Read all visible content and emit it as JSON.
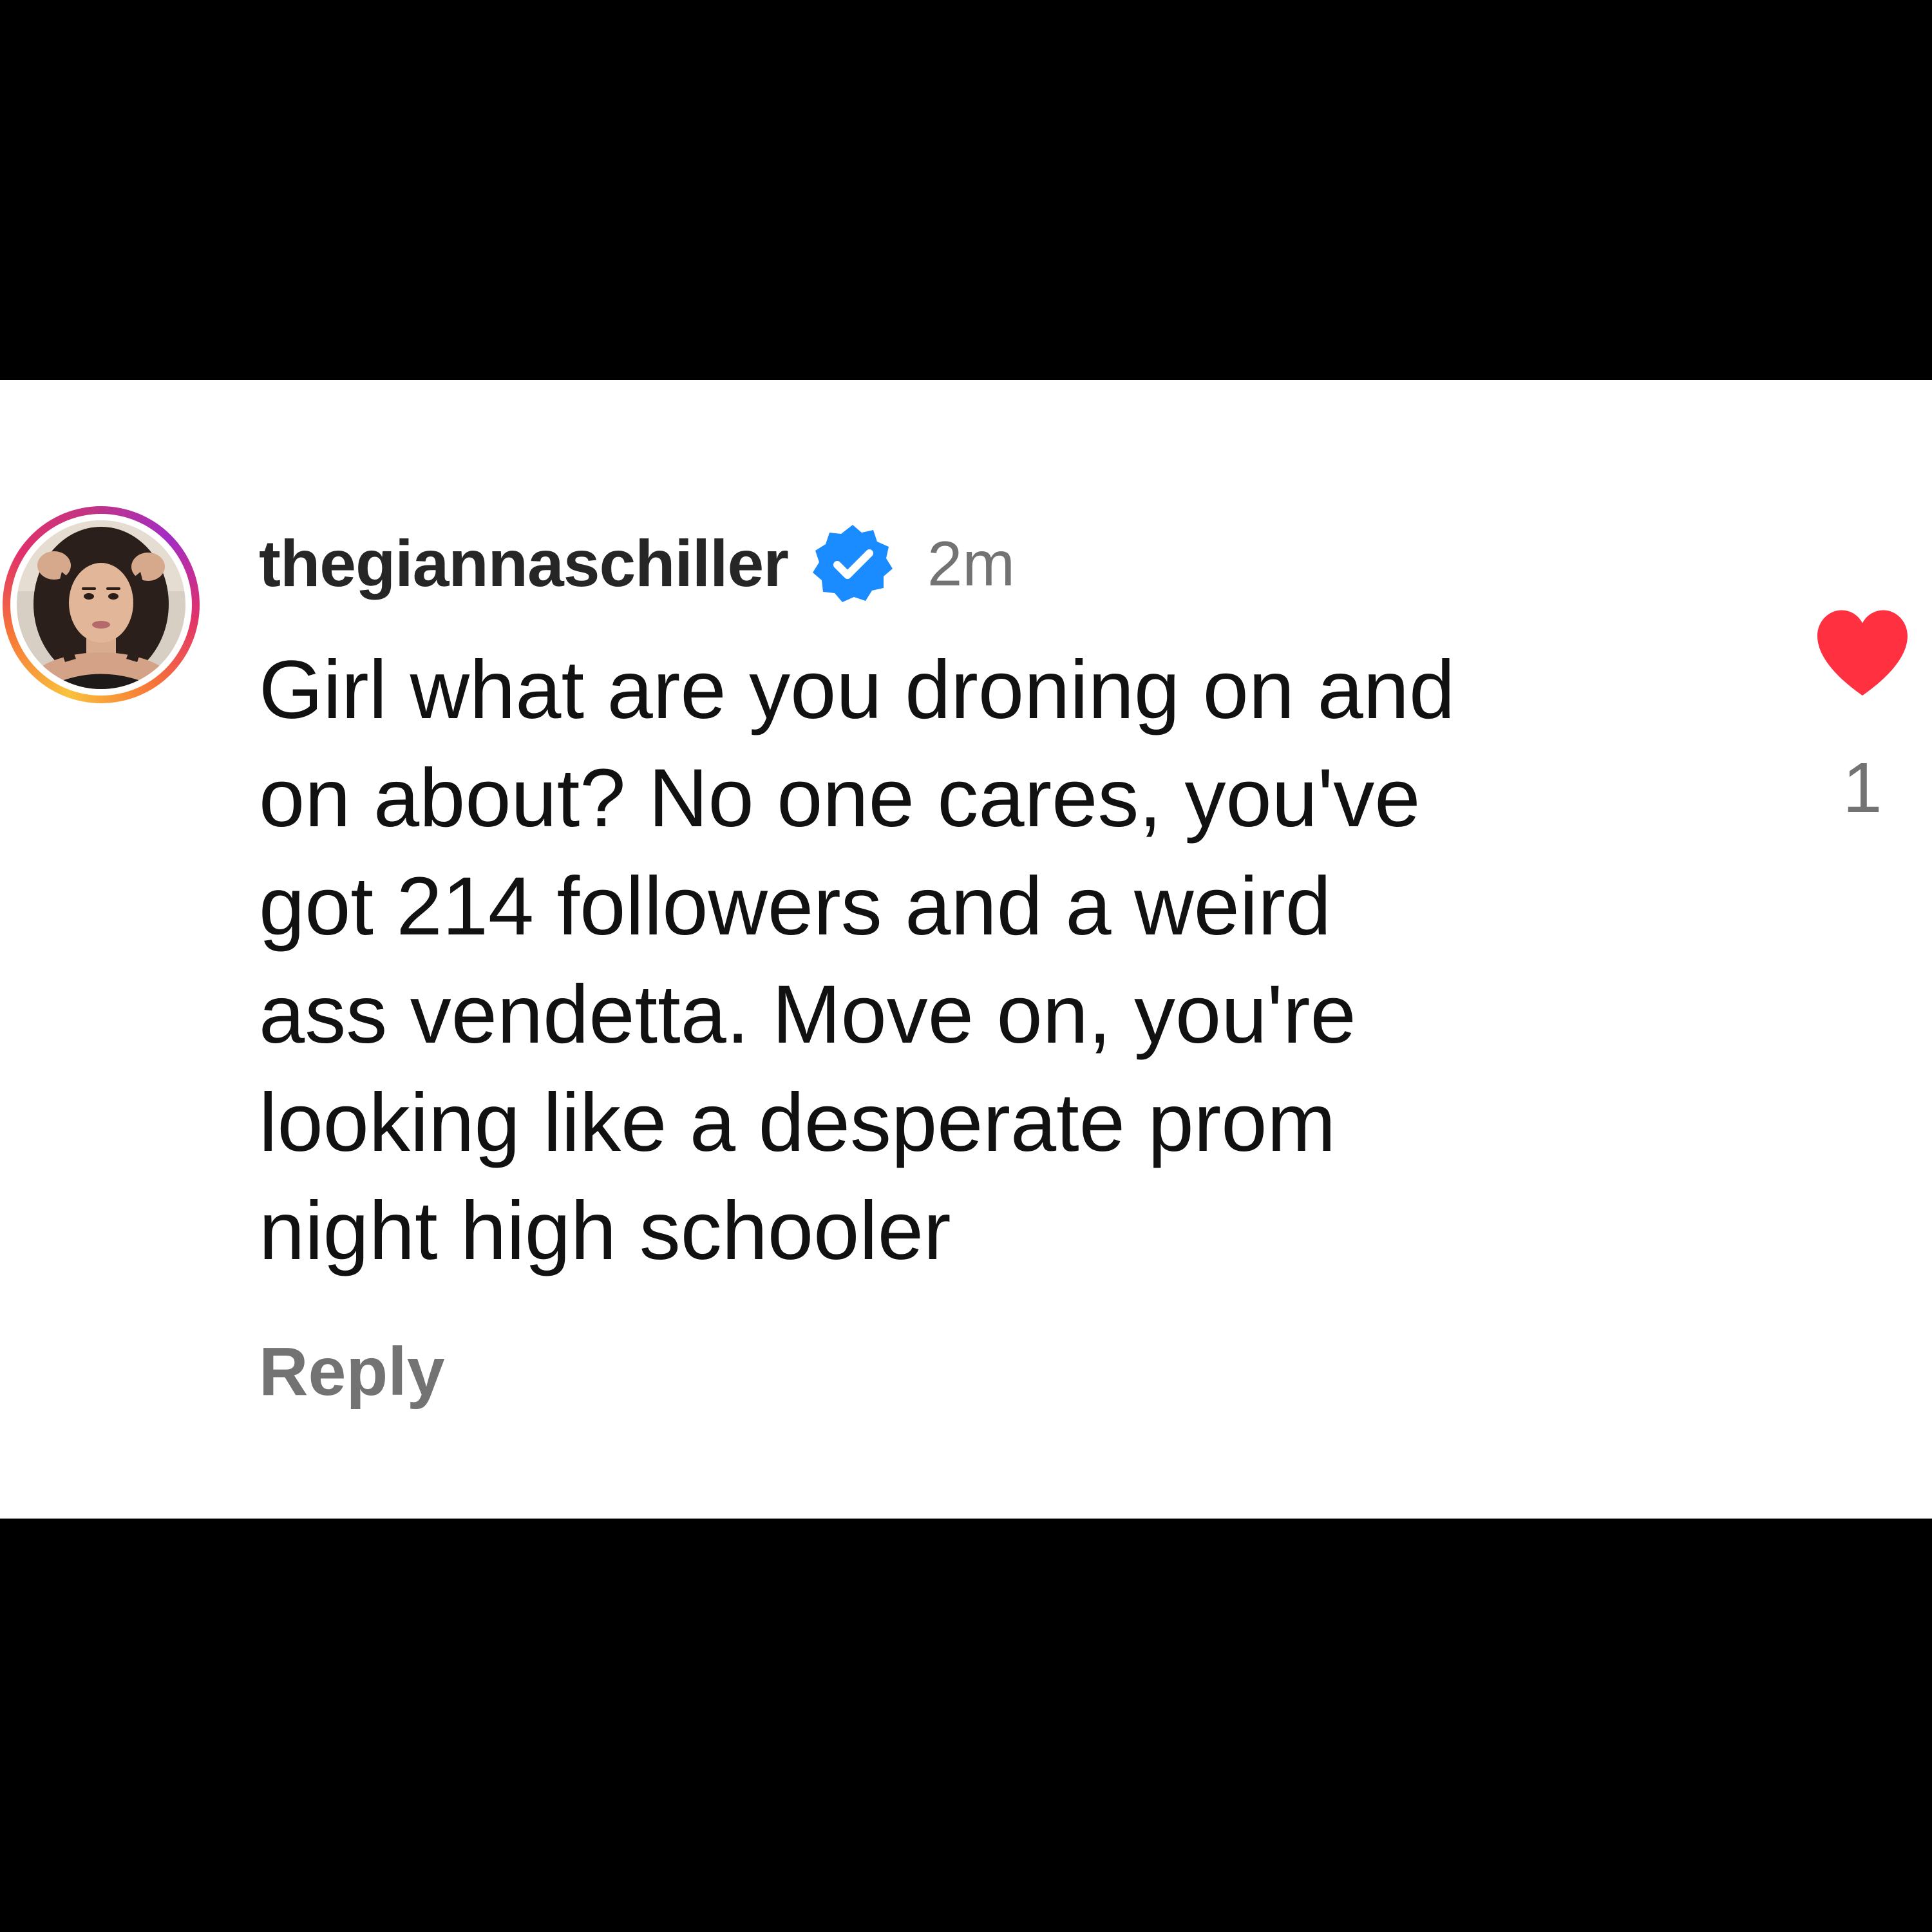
{
  "comment": {
    "username": "thegiannaschiller",
    "verified_icon": "verified-badge-icon",
    "timestamp": "2m",
    "text": "Girl what are you droning on and\non about? No one cares, you've\ngot 214 followers and a weird\nass vendetta. Move on, you're\nlooking like a desperate prom\nnight high schooler",
    "reply_label": "Reply",
    "like_icon": "heart-icon",
    "like_count": "1"
  },
  "colors": {
    "background": "#000000",
    "card": "#ffffff",
    "text": "#111111",
    "muted": "#737373",
    "verified": "#1a8cff",
    "like": "#ff3040"
  }
}
